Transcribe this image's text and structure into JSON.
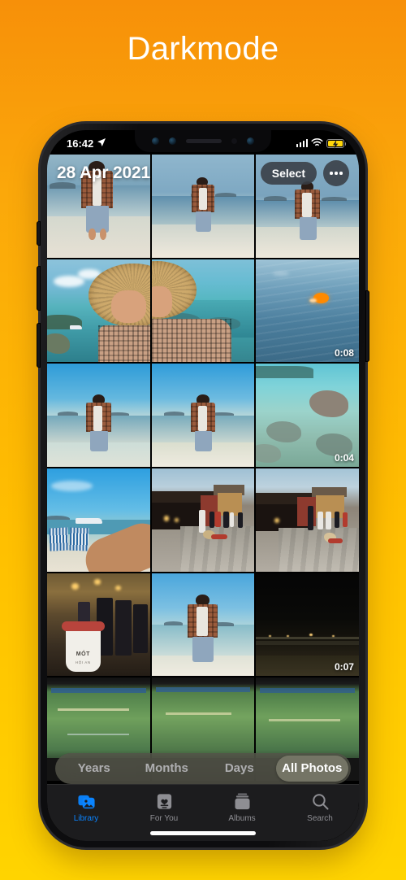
{
  "page": {
    "title": "Darkmode"
  },
  "theme": {
    "bg_top": "#F79009",
    "bg_bottom": "#FFD400",
    "accent_blue": "#0A84FF",
    "battery_yellow": "#FFD60A",
    "frame": "#0d0d0f"
  },
  "status_bar": {
    "time": "16:42",
    "location_icon": "location-arrow-icon",
    "signal_icon": "cellular-bars-icon",
    "wifi_icon": "wifi-icon",
    "battery_icon": "battery-charging-icon"
  },
  "header": {
    "date_title": "28 Apr 2021",
    "select_label": "Select",
    "more_icon": "ellipsis-icon"
  },
  "grid": {
    "columns": 3,
    "cells": [
      {
        "id": "p1",
        "kind": "photo",
        "desc": "man-standing-in-shallow-sea-back",
        "duration": ""
      },
      {
        "id": "p2",
        "kind": "photo",
        "desc": "man-walking-in-sea-with-islands",
        "duration": ""
      },
      {
        "id": "p3",
        "kind": "photo",
        "desc": "man-standing-in-sea-front",
        "duration": ""
      },
      {
        "id": "p4",
        "kind": "photo",
        "desc": "straw-hat-selfie-left-half",
        "duration": ""
      },
      {
        "id": "p5",
        "kind": "photo",
        "desc": "straw-hat-selfie-right-half",
        "duration": ""
      },
      {
        "id": "p6",
        "kind": "video",
        "desc": "orange-buoy-floating-in-sea",
        "duration": "0:08"
      },
      {
        "id": "p7",
        "kind": "photo",
        "desc": "man-in-sea-wide-sky",
        "duration": ""
      },
      {
        "id": "p8",
        "kind": "photo",
        "desc": "man-in-sea-wide-sky-2",
        "duration": ""
      },
      {
        "id": "p9",
        "kind": "video",
        "desc": "rocky-turquoise-shoreline",
        "duration": "0:04"
      },
      {
        "id": "p10",
        "kind": "photo",
        "desc": "beach-chairs-and-boat-with-arm",
        "duration": ""
      },
      {
        "id": "p11",
        "kind": "photo",
        "desc": "japanese-covered-bridge-hoi-an",
        "duration": ""
      },
      {
        "id": "p12",
        "kind": "photo",
        "desc": "japanese-covered-bridge-hoi-an-2",
        "duration": ""
      },
      {
        "id": "p13",
        "kind": "photo",
        "desc": "night-market-mot-hoi-an-drink",
        "duration": ""
      },
      {
        "id": "p14",
        "kind": "photo",
        "desc": "man-standing-in-sea-portrait",
        "duration": ""
      },
      {
        "id": "p15",
        "kind": "video",
        "desc": "dark-night-beach-pier",
        "duration": "0:07"
      },
      {
        "id": "p16",
        "kind": "photo",
        "desc": "map-screenshot-partial",
        "duration": ""
      },
      {
        "id": "p17",
        "kind": "photo",
        "desc": "map-screenshot-partial-2",
        "duration": ""
      },
      {
        "id": "p18",
        "kind": "photo",
        "desc": "map-screenshot-partial-3",
        "duration": ""
      }
    ],
    "cup_text": {
      "brand": "MÓT",
      "sub": "HỘI AN"
    }
  },
  "segmented": {
    "options": [
      "Years",
      "Months",
      "Days",
      "All Photos"
    ],
    "selected": "All Photos"
  },
  "tabbar": {
    "tabs": [
      {
        "label": "Library",
        "icon": "photo-stack-icon",
        "active": true
      },
      {
        "label": "For You",
        "icon": "for-you-card-icon",
        "active": false
      },
      {
        "label": "Albums",
        "icon": "albums-stack-icon",
        "active": false
      },
      {
        "label": "Search",
        "icon": "search-icon",
        "active": false
      }
    ]
  }
}
